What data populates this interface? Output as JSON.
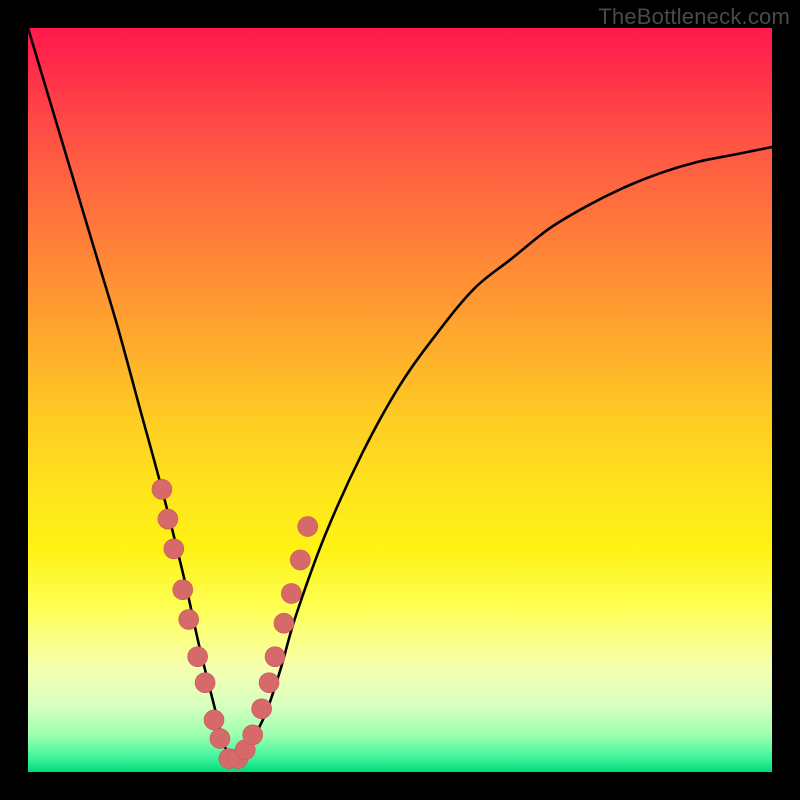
{
  "watermark": "TheBottleneck.com",
  "colors": {
    "gradient_top": "#ff1a4d",
    "gradient_mid": "#ffe41c",
    "gradient_bottom": "#00d978",
    "curve": "#000000",
    "markers": "#d66a6a",
    "frame": "#000000"
  },
  "chart_data": {
    "type": "line",
    "title": "",
    "xlabel": "",
    "ylabel": "",
    "xlim": [
      0,
      100
    ],
    "ylim": [
      0,
      100
    ],
    "grid": false,
    "legend": false,
    "notes": "Axes are unlabeled; values are normalized 0–100. y is plotted with 100 at top, 0 at bottom. Curve resembles a bottleneck/V shape with minimum near x≈27.",
    "series": [
      {
        "name": "curve",
        "x": [
          0,
          3,
          6,
          9,
          12,
          15,
          18,
          21,
          23,
          25,
          26,
          27,
          28,
          29,
          30,
          32,
          34,
          36,
          40,
          45,
          50,
          55,
          60,
          65,
          70,
          75,
          80,
          85,
          90,
          95,
          100
        ],
        "y": [
          100,
          90,
          80,
          70,
          60,
          49,
          38,
          26,
          17,
          9,
          5,
          2,
          1,
          2,
          4,
          8,
          14,
          21,
          32,
          43,
          52,
          59,
          65,
          69,
          73,
          76,
          78.5,
          80.5,
          82,
          83,
          84
        ]
      }
    ],
    "markers": {
      "name": "highlighted-points",
      "x": [
        18.0,
        18.8,
        19.6,
        20.8,
        21.6,
        22.8,
        23.8,
        25.0,
        25.8,
        27.0,
        28.2,
        29.2,
        30.2,
        31.4,
        32.4,
        33.2,
        34.4,
        35.4,
        36.6,
        37.6
      ],
      "y": [
        38.0,
        34.0,
        30.0,
        24.5,
        20.5,
        15.5,
        12.0,
        7.0,
        4.5,
        1.8,
        1.8,
        3.0,
        5.0,
        8.5,
        12.0,
        15.5,
        20.0,
        24.0,
        28.5,
        33.0
      ],
      "radius": 10
    }
  }
}
